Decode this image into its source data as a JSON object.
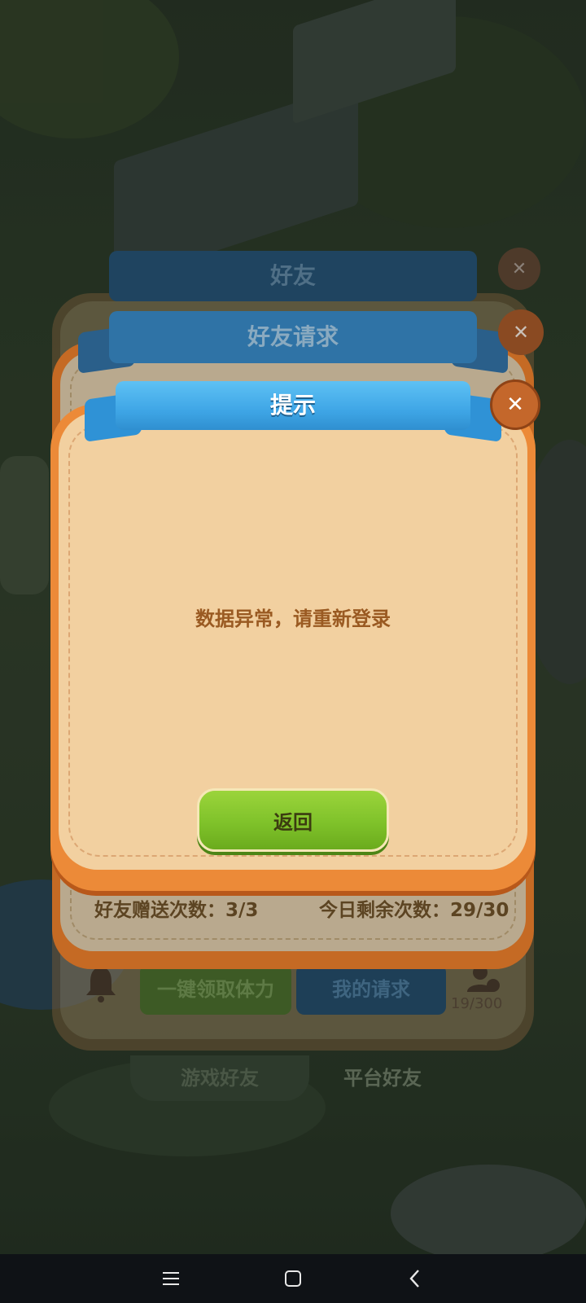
{
  "background": {
    "panel_friends": {
      "title": "好友"
    },
    "bottom_bar": {
      "claim_all_label": "一键领取体力",
      "my_requests_label": "我的请求",
      "friend_count": "19/300"
    },
    "tabs": [
      {
        "label": "游戏好友"
      },
      {
        "label": "平台好友"
      }
    ]
  },
  "panel_requests": {
    "title": "好友请求",
    "gift_count_label": "好友赠送次数：3/3",
    "remaining_label": "今日剩余次数：29/30"
  },
  "dialog": {
    "title": "提示",
    "message": "数据异常，请重新登录",
    "return_label": "返回"
  },
  "colors": {
    "ribbon_blue": "#3fa6e6",
    "dialog_orange": "#ec8a38",
    "dialog_cream": "#f2d0a0",
    "message_text": "#9a5a22",
    "button_green": "#7fc22a",
    "close_brown": "#c4672b"
  },
  "icons": {
    "close": "close-icon",
    "bell": "bell-icon",
    "add_friend": "add-friend-icon",
    "nav_menu": "menu-icon",
    "nav_home": "home-icon",
    "nav_back": "back-icon"
  }
}
